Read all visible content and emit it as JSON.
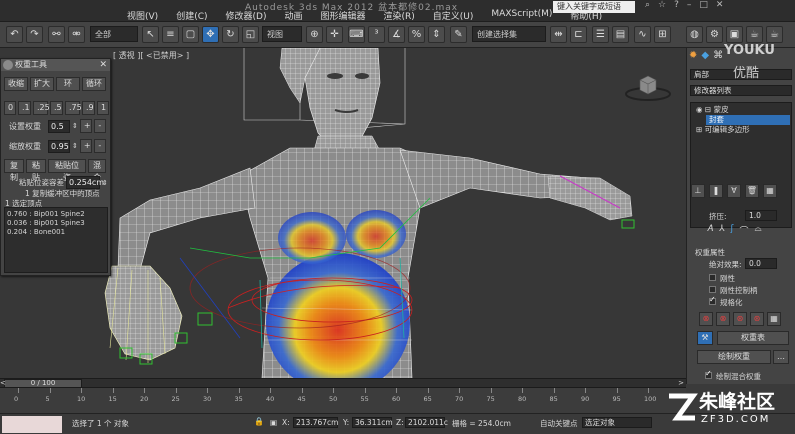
{
  "window": {
    "title": "Autodesk 3ds Max 2012    盆本都修02.max",
    "menu": [
      "视图(V)",
      "创建(C)",
      "修改器(D)",
      "动画",
      "图形编辑器",
      "渲染(R)",
      "自定义(U)",
      "MAXScript(M)",
      "帮助(H)"
    ],
    "search_placeholder": "键入关键字或短语"
  },
  "toolbar": {
    "selection_filter": "全部",
    "view_dropdown": "视图",
    "named_selection": "创建选择集"
  },
  "viewport": {
    "label": "[ 透视 ][ <已禁用> ]"
  },
  "weight_tool": {
    "title": "权重工具",
    "row1": [
      "收缩",
      "扩大",
      "环",
      "循环"
    ],
    "presets": [
      "0",
      ".1",
      ".25",
      ".5",
      ".75",
      ".9",
      "1"
    ],
    "set_weight_label": "设置权重",
    "set_weight_value": "0.5",
    "scale_weight_label": "缩放权重",
    "scale_weight_value": "0.95",
    "row_copy": [
      "复制",
      "粘贴",
      "粘贴位姿",
      "混合"
    ],
    "tolerance_label": "粘贴位姿容差",
    "tolerance_value": "0.254cm",
    "buffer_info": "1 复制缓冲区中的顶点",
    "selected_vertex_label": "1 选定顶点",
    "vertex_weights": [
      "0.760 : Bip001 Spine2",
      "0.036 : Bip001 Spine3",
      "0.204 : Bone001"
    ]
  },
  "command_panel": {
    "object_name": "肩部",
    "modifier_list": "修改器列表",
    "stack": [
      "蒙皮",
      "封套",
      "可编辑多边形"
    ],
    "squash_label": "挤压:",
    "squash_value": "1.0",
    "weight_props_title": "权重属性",
    "abs_effect_label": "绝对效果:",
    "abs_effect_value": "0.0",
    "rigid_label": "刚性",
    "rigid_handles_label": "刚性控制柄",
    "normalize_label": "规格化",
    "weight_table_button": "权重表",
    "paint_weights_button": "绘制权重",
    "paint_blend_label": "绘制混合权重"
  },
  "timeline": {
    "frame_readout": "0 / 100",
    "tick_labels": [
      "0",
      "5",
      "10",
      "15",
      "20",
      "25",
      "30",
      "35",
      "40",
      "45",
      "50",
      "55",
      "60",
      "65",
      "70",
      "75",
      "80",
      "85",
      "90",
      "95",
      "100"
    ]
  },
  "status": {
    "selection_text": "选择了 1 个 对象",
    "x_label": "X:",
    "x_value": "213.767cm",
    "y_label": "Y:",
    "y_value": "36.311cm",
    "z_label": "Z:",
    "z_value": "2102.011c",
    "grid_text": "栅格 = 254.0cm",
    "autokey_label": "自动关键点",
    "selected_objects": "选定对象"
  },
  "watermark": {
    "youku_top": "YOUKU",
    "youku_bottom": "优酷",
    "zf_main": "朱峰社区",
    "zf_url": "ZF3D.COM"
  },
  "colors": {
    "selection_blue": "#2f6fb5",
    "wire_white": "#e8e8e8",
    "envelope_red": "#c82020",
    "heat_high": "#e0301a",
    "heat_low": "#1c3cc8"
  }
}
